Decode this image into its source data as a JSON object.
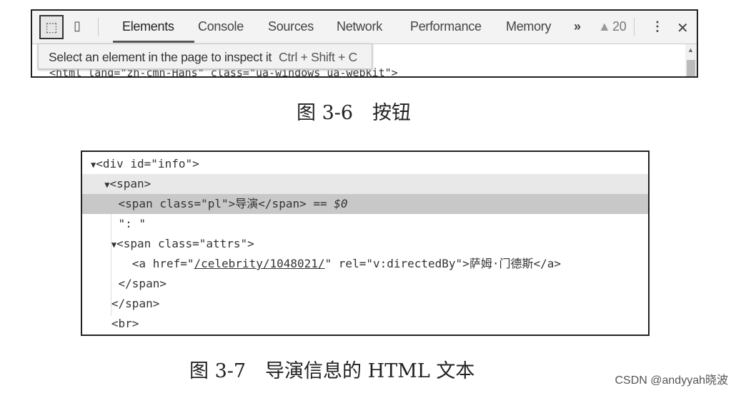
{
  "devtools": {
    "tabs": [
      "Elements",
      "Console",
      "Sources",
      "Network",
      "Performance",
      "Memory"
    ],
    "active_tab": "Elements",
    "more_label": "»",
    "warning_icon": "warning-triangle-icon",
    "warning_count": "20",
    "tooltip": {
      "text": "Select an element in the page to inspect it",
      "shortcut": "Ctrl + Shift + C"
    },
    "html_line": "<html lang=\"zh-cmn-Hans\" class=\"ua-windows ua-webkit\">"
  },
  "caption1": "图 3-6　按钮",
  "code": {
    "lines": [
      {
        "indent": "",
        "toggle": "▼",
        "parts": [
          {
            "t": "<div id=\"info\">"
          }
        ]
      },
      {
        "indent": "  ",
        "toggle": "▼",
        "parts": [
          {
            "t": "<span>"
          }
        ]
      },
      {
        "indent": "    ",
        "toggle": "",
        "parts": [
          {
            "t": "<span class=\"pl\">导演</span> == "
          },
          {
            "t": "$0",
            "i": true
          }
        ]
      },
      {
        "indent": "    ",
        "toggle": "",
        "parts": [
          {
            "t": "\": \""
          }
        ]
      },
      {
        "indent": "   ",
        "toggle": "▼",
        "parts": [
          {
            "t": "<span class=\"attrs\">"
          }
        ]
      },
      {
        "indent": "      ",
        "toggle": "",
        "parts": [
          {
            "t": "<a href=\""
          },
          {
            "t": "/celebrity/1048021/",
            "u": true
          },
          {
            "t": "\" rel=\"v:directedBy\">萨姆·门德斯</a>"
          }
        ]
      },
      {
        "indent": "    ",
        "toggle": "",
        "parts": [
          {
            "t": "</span>"
          }
        ]
      },
      {
        "indent": "   ",
        "toggle": "",
        "parts": [
          {
            "t": "</span>"
          }
        ]
      },
      {
        "indent": "   ",
        "toggle": "",
        "parts": [
          {
            "t": "<br>"
          }
        ]
      }
    ]
  },
  "caption2": "图 3-7　导演信息的 HTML 文本",
  "watermark": "CSDN @andyyah晓波"
}
